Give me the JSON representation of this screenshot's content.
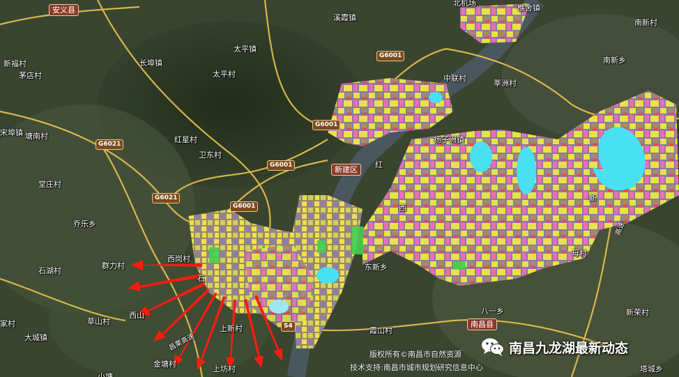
{
  "map": {
    "places": [
      {
        "id": "anyi-county",
        "label": "安义县",
        "kind": "county"
      },
      {
        "id": "xixi-town",
        "label": "溪霞镇",
        "kind": "place"
      },
      {
        "id": "qiaoshe-village",
        "label": "樵舍镇",
        "kind": "place"
      },
      {
        "id": "beiji-airport",
        "label": "北机场",
        "kind": "place"
      },
      {
        "id": "nanxin-village",
        "label": "南新村",
        "kind": "place"
      },
      {
        "id": "xinfu-village",
        "label": "新福村",
        "kind": "place"
      },
      {
        "id": "maodian-village",
        "label": "茅店村",
        "kind": "place"
      },
      {
        "id": "taiping-town",
        "label": "太平镇",
        "kind": "place"
      },
      {
        "id": "changbu-town",
        "label": "长埠镇",
        "kind": "place"
      },
      {
        "id": "taiping-village",
        "label": "太平村",
        "kind": "place"
      },
      {
        "id": "zhonglian-village",
        "label": "中联村",
        "kind": "place"
      },
      {
        "id": "nanxin-town",
        "label": "南新乡",
        "kind": "place"
      },
      {
        "id": "songbu-town",
        "label": "宋埠镇",
        "kind": "place"
      },
      {
        "id": "tangnan-village",
        "label": "塘南村",
        "kind": "place"
      },
      {
        "id": "hongxing-village",
        "label": "红星村",
        "kind": "place"
      },
      {
        "id": "weidong-village",
        "label": "卫东村",
        "kind": "place"
      },
      {
        "id": "xinzhou-village",
        "label": "莘洲村",
        "kind": "place"
      },
      {
        "id": "yangzizhou-town",
        "label": "扬子洲镇",
        "kind": "place"
      },
      {
        "id": "xinjian-district",
        "label": "新建区",
        "kind": "county"
      },
      {
        "id": "tangzhuang-village",
        "label": "堂庄村",
        "kind": "place"
      },
      {
        "id": "qiaole-town",
        "label": "乔乐乡",
        "kind": "place"
      },
      {
        "id": "xigang-village",
        "label": "西岗村",
        "kind": "place"
      },
      {
        "id": "qunli-village",
        "label": "群力村",
        "kind": "place"
      },
      {
        "id": "shihu-village",
        "label": "石湖村",
        "kind": "place"
      },
      {
        "id": "dongxin-town",
        "label": "东新乡",
        "kind": "place"
      },
      {
        "id": "mu-village",
        "label": "母村",
        "kind": "place"
      },
      {
        "id": "bayi-town",
        "label": "八一乡",
        "kind": "place"
      },
      {
        "id": "caobu-village",
        "label": "草山村",
        "kind": "place"
      },
      {
        "id": "xishan-town",
        "label": "西山",
        "kind": "place"
      },
      {
        "id": "shangxin-village",
        "label": "上新村",
        "kind": "place"
      },
      {
        "id": "xiashan-village",
        "label": "霞山村",
        "kind": "place"
      },
      {
        "id": "nanchang-county",
        "label": "南昌县",
        "kind": "county"
      },
      {
        "id": "xinrong-village",
        "label": "新荣村",
        "kind": "place"
      },
      {
        "id": "jia-village",
        "label": "家村",
        "kind": "place"
      },
      {
        "id": "dacheng-town",
        "label": "大城镇",
        "kind": "place"
      },
      {
        "id": "jintang-village",
        "label": "金塘村",
        "kind": "place"
      },
      {
        "id": "shangfang-village",
        "label": "上坊村",
        "kind": "place"
      },
      {
        "id": "xiaoling-village",
        "label": "小塘",
        "kind": "place"
      },
      {
        "id": "tacheng-village",
        "label": "塔城乡",
        "kind": "place"
      },
      {
        "id": "shi-label",
        "label": "石",
        "kind": "place"
      },
      {
        "id": "hong-label",
        "label": "红",
        "kind": "place"
      },
      {
        "id": "xi-label",
        "label": "西",
        "kind": "place"
      },
      {
        "id": "xin-label",
        "label": "新",
        "kind": "place"
      }
    ],
    "highway_shields": [
      {
        "id": "g6001-a",
        "label": "G6001"
      },
      {
        "id": "g6001-b",
        "label": "G6001"
      },
      {
        "id": "g6001-c",
        "label": "G6001"
      },
      {
        "id": "g6001-d",
        "label": "G6001"
      },
      {
        "id": "g6021-a",
        "label": "G6021"
      },
      {
        "id": "g6021-b",
        "label": "G6021"
      },
      {
        "id": "s4-a",
        "label": "S4"
      }
    ],
    "road_labels": [
      {
        "id": "changyan-expressway",
        "label": "昌栗高速"
      },
      {
        "id": "east-expressway",
        "label": "高速"
      }
    ],
    "credits": {
      "copyright": "版权所有©南昌市自然资源",
      "tech_support": "技术支持:南昌市城市规划研究信息中心"
    },
    "watermark": {
      "icon": "wechat-icon",
      "text": "南昌九龙湖最新动态"
    },
    "colors": {
      "arrow": "#ff1a10",
      "water": "#49e0f2",
      "road": "#e9c34e"
    }
  }
}
